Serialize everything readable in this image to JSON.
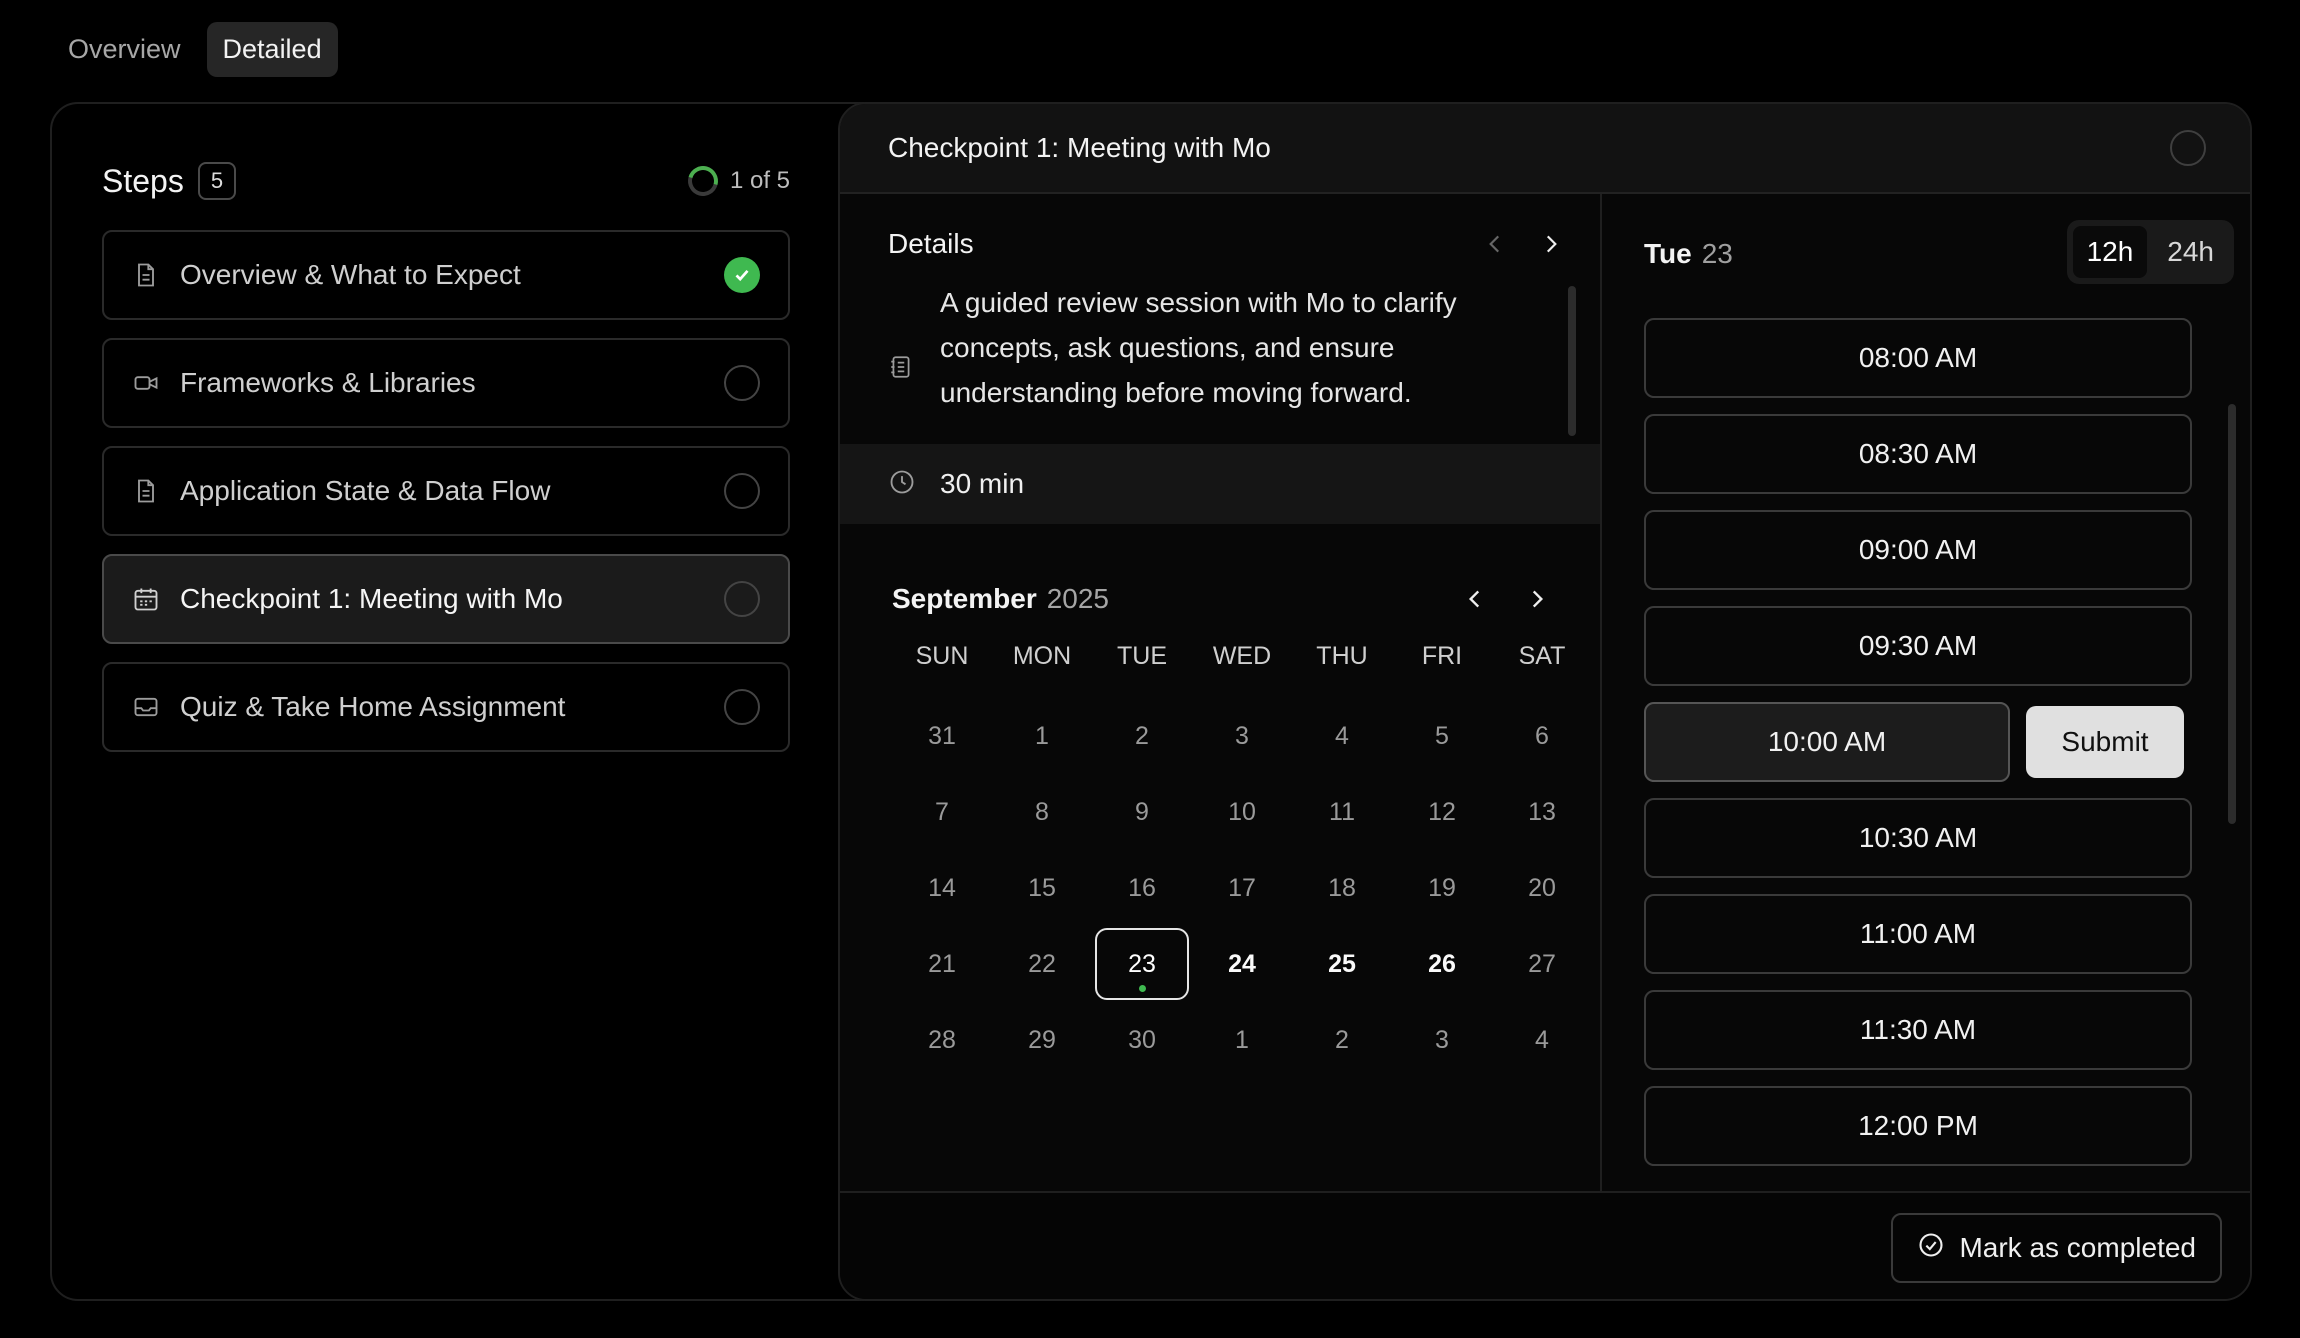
{
  "tabs": {
    "overview": "Overview",
    "detailed": "Detailed"
  },
  "steps": {
    "title": "Steps",
    "count": "5",
    "progress_text": "1 of 5",
    "items": [
      {
        "label": "Overview & What to Expect",
        "icon": "document-icon",
        "completed": true
      },
      {
        "label": "Frameworks & Libraries",
        "icon": "video-icon",
        "completed": false
      },
      {
        "label": "Application State & Data Flow",
        "icon": "document-icon",
        "completed": false
      },
      {
        "label": "Checkpoint 1: Meeting with Mo",
        "icon": "calendar-icon",
        "completed": false,
        "active": true
      },
      {
        "label": "Quiz & Take Home Assignment",
        "icon": "inbox-icon",
        "completed": false
      }
    ]
  },
  "detail": {
    "title": "Checkpoint 1: Meeting with Mo",
    "details_label": "Details",
    "description": "A guided review session with Mo to clarify concepts, ask questions, and ensure understanding before moving forward.",
    "duration": "30 min"
  },
  "calendar": {
    "month": "September",
    "year": "2025",
    "weekdays": [
      "SUN",
      "MON",
      "TUE",
      "WED",
      "THU",
      "FRI",
      "SAT"
    ],
    "weeks": [
      [
        "31",
        "1",
        "2",
        "3",
        "4",
        "5",
        "6"
      ],
      [
        "7",
        "8",
        "9",
        "10",
        "11",
        "12",
        "13"
      ],
      [
        "14",
        "15",
        "16",
        "17",
        "18",
        "19",
        "20"
      ],
      [
        "21",
        "22",
        "23",
        "24",
        "25",
        "26",
        "27"
      ],
      [
        "28",
        "29",
        "30",
        "1",
        "2",
        "3",
        "4"
      ]
    ],
    "selected": "23",
    "available": [
      "24",
      "25",
      "26"
    ]
  },
  "schedule": {
    "day_label": "Tue",
    "day_number": "23",
    "format_12h": "12h",
    "format_24h": "24h",
    "slots": [
      "08:00 AM",
      "08:30 AM",
      "09:00 AM",
      "09:30 AM",
      "10:00 AM",
      "10:30 AM",
      "11:00 AM",
      "11:30 AM",
      "12:00 PM"
    ],
    "selected_slot": "10:00 AM",
    "submit_label": "Submit"
  },
  "footer": {
    "complete_label": "Mark as completed"
  },
  "colors": {
    "accent_green": "#3fb950",
    "background": "#000000"
  }
}
